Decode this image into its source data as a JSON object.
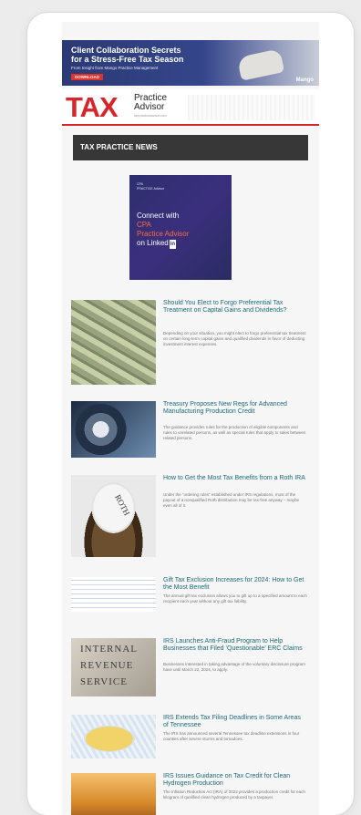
{
  "banner": {
    "line1": "Client Collaboration Secrets",
    "line2": "for a Stress-Free Tax Season",
    "subtitle": "From Insight from Mango Practice Management",
    "button": "DOWNLOAD",
    "brand": "Mango"
  },
  "masthead": {
    "logo_word": "TAX",
    "logo_line1": "Practice",
    "logo_line2": "Advisor",
    "logo_line3": "taxpracticeadvisor.com"
  },
  "section_title": "TAX PRACTICE NEWS",
  "ad": {
    "logo1": "CPA",
    "logo2": "PRACTICE Advisor",
    "line1": "Connect with",
    "line2": "CPA",
    "line3": "Practice Advisor",
    "line4": "on",
    "linkedin_text": "Linked",
    "linkedin_badge": "in"
  },
  "articles": [
    {
      "title": "Should You Elect to Forgo Preferential Tax Treatment on Capital Gains and Dividends?",
      "body": "Depending on your situation, you might elect to forgo preferential tax treatment on certain long-term capital gains and qualified dividends in favor of deducting investment interest expenses.",
      "thumb_icon": "money-stack-image"
    },
    {
      "title": "Treasury Proposes New Regs for Advanced Manufacturing Production Credit",
      "body": "The guidance provides rules for the production of eligible components and rules to unrelated persons, as well as special rules that apply to sales between related persons.",
      "thumb_icon": "gears-image"
    },
    {
      "title": "How to Get the Most Tax Benefits from a Roth IRA",
      "body": "Under the “ordering rules” established under IRS regulations, most of the payout of a nonqualified Roth distribution may be tax-free anyway – maybe even all of it.",
      "thumb_icon": "roth-egg-image",
      "thumb_text": "ROTH"
    },
    {
      "title": "Gift Tax Exclusion Increases for 2024: How to Get the Most Benefit",
      "body": "The annual gift tax exclusion allows you to gift up to a specified amount to each recipient each year without any gift tax liability.",
      "thumb_icon": "tax-form-image"
    },
    {
      "title": "IRS Launches Anti-Fraud Program to Help Businesses that Filed ‘Questionable’ ERC Claims",
      "body": "Businesses interested in taking advantage of the voluntary disclosure program have until March 22, 2024, to apply.",
      "thumb_icon": "irs-sign-image",
      "thumb_lines": [
        "INTERNAL",
        "REVENUE",
        "SERVICE"
      ]
    },
    {
      "title": "IRS Extends Tax Filing Deadlines in Some Areas of Tennessee",
      "body": "The IRS has announced several Tennessee tax deadline extensions in four counties after severe storms and tornadoes.",
      "thumb_icon": "tennessee-map-image"
    },
    {
      "title": "IRS Issues Guidance on Tax Credit for Clean Hydrogen Production",
      "body": "The Inflation Reduction Act (IRA) of 2022 provides a production credit for each kilogram of qualified clean hydrogen produced by a taxpayer.",
      "thumb_icon": "hydrogen-plant-image"
    }
  ]
}
